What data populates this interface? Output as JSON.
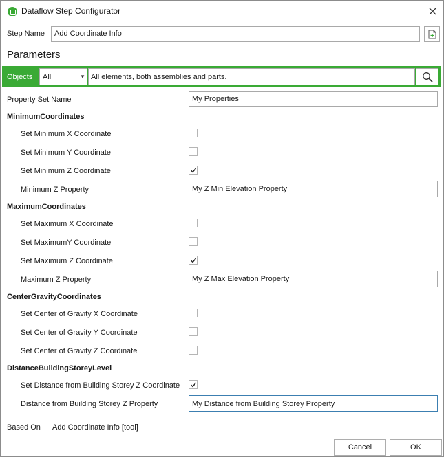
{
  "window": {
    "title": "Dataflow Step Configurator"
  },
  "step_name": {
    "label": "Step Name",
    "value": "Add Coordinate Info"
  },
  "parameters_title": "Parameters",
  "objects": {
    "label": "Objects",
    "selected": "All",
    "description": "All elements, both assemblies and parts."
  },
  "property_set": {
    "label": "Property Set Name",
    "value": "My Properties"
  },
  "minimum": {
    "header": "MinimumCoordinates",
    "x_label": "Set Minimum X Coordinate",
    "x_checked": false,
    "y_label": "Set Minimum Y Coordinate",
    "y_checked": false,
    "z_label": "Set Minimum Z Coordinate",
    "z_checked": true,
    "prop_label": "Minimum Z Property",
    "prop_value": "My Z Min Elevation Property"
  },
  "maximum": {
    "header": "MaximumCoordinates",
    "x_label": "Set Maximum X Coordinate",
    "x_checked": false,
    "y_label": "Set MaximumY Coordinate",
    "y_checked": false,
    "z_label": "Set Maximum Z Coordinate",
    "z_checked": true,
    "prop_label": "Maximum Z Property",
    "prop_value": "My Z Max Elevation Property"
  },
  "center": {
    "header": "CenterGravityCoordinates",
    "x_label": "Set Center of Gravity X Coordinate",
    "x_checked": false,
    "y_label": "Set Center of Gravity Y Coordinate",
    "y_checked": false,
    "z_label": "Set Center of Gravity Z Coordinate",
    "z_checked": false
  },
  "distance": {
    "header": "DistanceBuildingStoreyLevel",
    "set_label": "Set Distance from Building Storey Z Coordinate",
    "set_checked": true,
    "prop_label": "Distance from Building Storey Z Property",
    "prop_value": "My Distance from Building Storey Property"
  },
  "based_on": {
    "label": "Based On",
    "value": "Add Coordinate Info [tool]"
  },
  "buttons": {
    "cancel": "Cancel",
    "ok": "OK"
  },
  "colors": {
    "accent": "#3aaa35",
    "border": "#a9a9a9",
    "focus": "#3c7fb1"
  }
}
